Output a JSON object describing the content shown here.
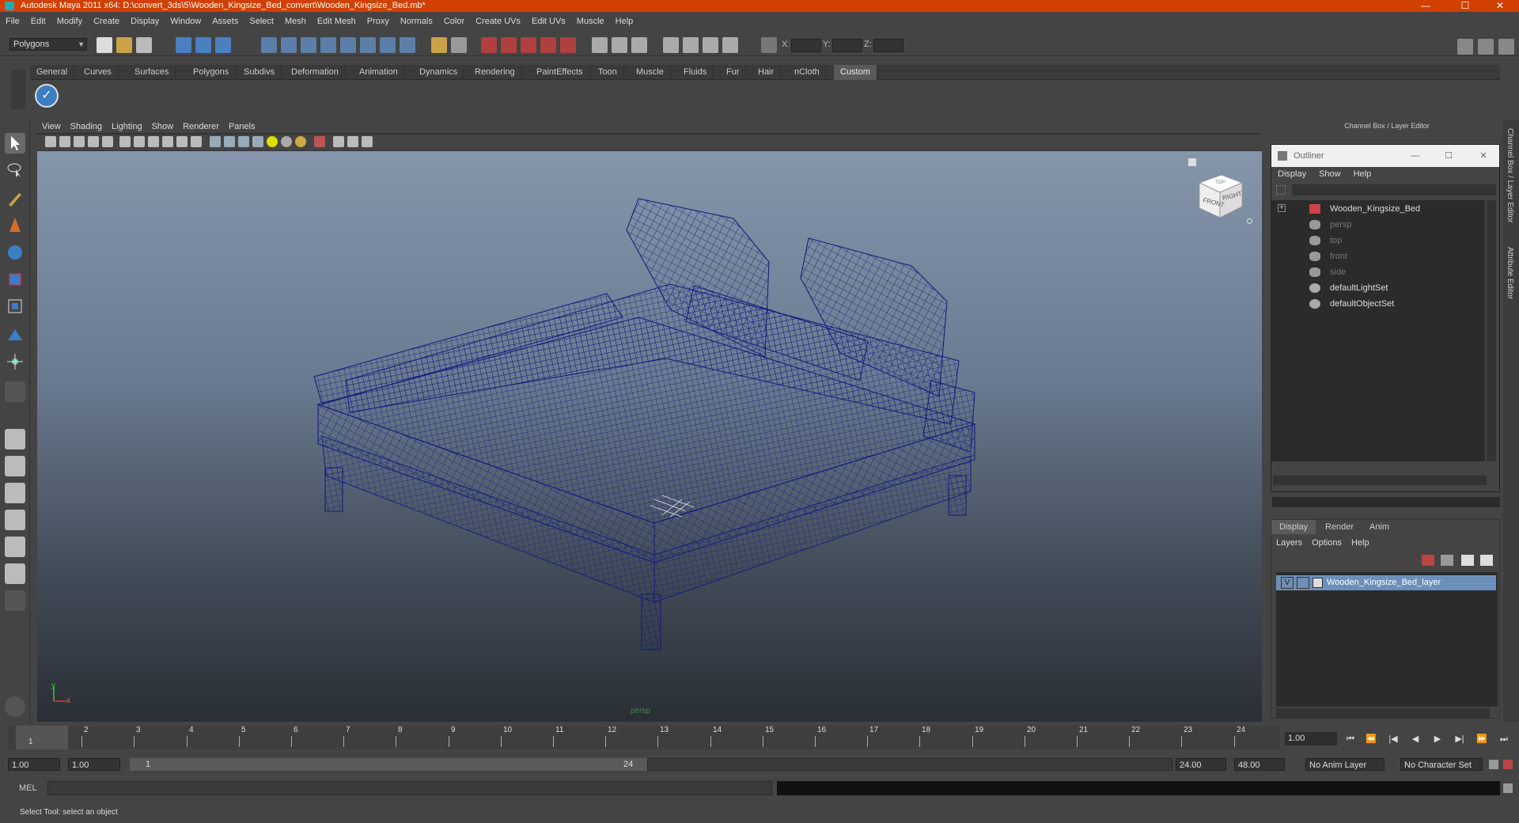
{
  "title": "Autodesk Maya 2011 x64: D:\\convert_3ds\\5\\Wooden_Kingsize_Bed_convert\\Wooden_Kingsize_Bed.mb*",
  "window_controls": {
    "minimize": "—",
    "maximize": "☐",
    "close": "✕"
  },
  "menu": [
    "File",
    "Edit",
    "Modify",
    "Create",
    "Display",
    "Window",
    "Assets",
    "Select",
    "Mesh",
    "Edit Mesh",
    "Proxy",
    "Normals",
    "Color",
    "Create UVs",
    "Edit UVs",
    "Muscle",
    "Help"
  ],
  "mode_selector": {
    "value": "Polygons"
  },
  "xyz_labels": {
    "x": "X:",
    "y": "Y:",
    "z": "Z:"
  },
  "shelf_tabs": [
    "General",
    "Curves",
    "Surfaces",
    "Polygons",
    "Subdivs",
    "Deformation",
    "Animation",
    "Dynamics",
    "Rendering",
    "PaintEffects",
    "Toon",
    "Muscle",
    "Fluids",
    "Fur",
    "Hair",
    "nCloth",
    "Custom"
  ],
  "shelf_active": "Custom",
  "viewport": {
    "menu": [
      "View",
      "Shading",
      "Lighting",
      "Show",
      "Renderer",
      "Panels"
    ],
    "camera_label": "persp",
    "viewcube": {
      "front": "FRONT",
      "right": "RIGHT",
      "top": "TOP"
    },
    "axis": {
      "x": "x",
      "y": "y"
    },
    "wire_color": "#101a80"
  },
  "channel_box": {
    "title": "Channel Box / Layer Editor"
  },
  "outliner": {
    "title": "Outliner",
    "menu": [
      "Display",
      "Show",
      "Help"
    ],
    "expand": "+",
    "items": [
      {
        "label": "Wooden_Kingsize_Bed",
        "icon": "mesh-icon",
        "dim": false
      },
      {
        "label": "persp",
        "icon": "camera-icon",
        "dim": true
      },
      {
        "label": "top",
        "icon": "camera-icon",
        "dim": true
      },
      {
        "label": "front",
        "icon": "camera-icon",
        "dim": true
      },
      {
        "label": "side",
        "icon": "camera-icon",
        "dim": true
      },
      {
        "label": "defaultLightSet",
        "icon": "set-icon",
        "dim": false
      },
      {
        "label": "defaultObjectSet",
        "icon": "set-icon",
        "dim": false
      }
    ]
  },
  "layer_editor": {
    "tabs": [
      "Display",
      "Render",
      "Anim"
    ],
    "active_tab": "Display",
    "menu": [
      "Layers",
      "Options",
      "Help"
    ],
    "layer": {
      "visible": "V",
      "name": "Wooden_Kingsize_Bed_layer"
    }
  },
  "side_tabs": [
    "Channel Box / Layer Editor",
    "Attribute Editor"
  ],
  "timeline": {
    "ticks": [
      "1",
      "2",
      "3",
      "4",
      "5",
      "6",
      "7",
      "8",
      "9",
      "10",
      "11",
      "12",
      "13",
      "14",
      "15",
      "16",
      "17",
      "18",
      "19",
      "20",
      "21",
      "22",
      "23",
      "24"
    ],
    "current_marker": "1",
    "current_frame": "1.00",
    "playback_buttons": [
      "⏮",
      "⏪",
      "|◀",
      "◀",
      "▶",
      "▶|",
      "⏩",
      "⏭"
    ]
  },
  "range": {
    "start": "1.00",
    "playback_start": "1.00",
    "slider_start": "1",
    "slider_end": "24",
    "playback_end": "24.00",
    "end": "48.00",
    "anim_layer": "No Anim Layer",
    "character_set": "No Character Set"
  },
  "command_line": {
    "label": "MEL"
  },
  "help_line": "Select Tool: select an object"
}
